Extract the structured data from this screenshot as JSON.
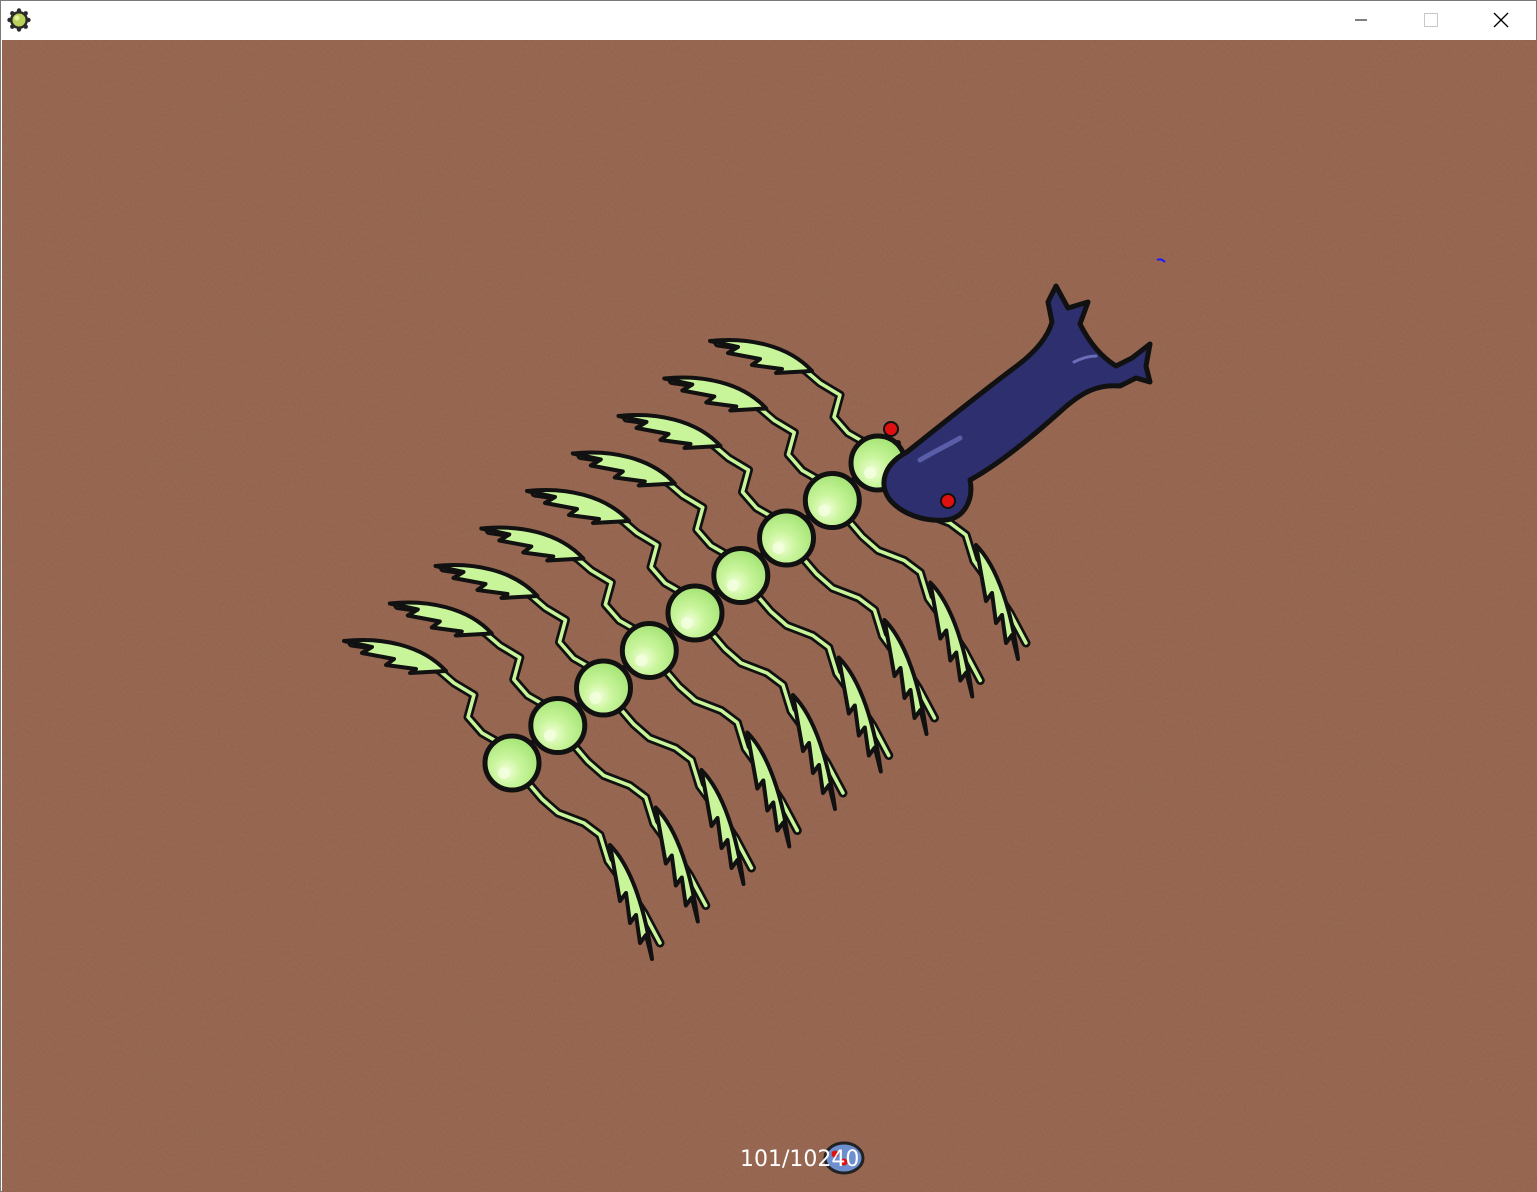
{
  "window": {
    "title": "",
    "app_icon": "gear-creature-icon",
    "controls": {
      "minimize": "minimize-icon",
      "maximize": "maximize-icon",
      "close": "close-icon"
    }
  },
  "game": {
    "background_color": "#93604a",
    "creature_color": "#2d2f6e",
    "creature_eye_color": "#e01010",
    "prey_color": "#c8f59a",
    "outline_color": "#111111",
    "hud": {
      "counter": "101/10240",
      "player_icon": "player-creature-icon"
    }
  }
}
